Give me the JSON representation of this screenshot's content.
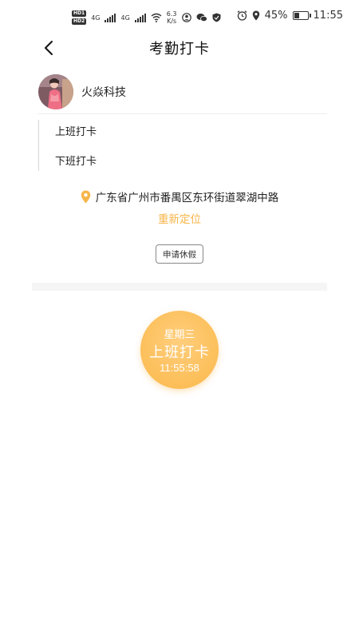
{
  "status_bar": {
    "hd1": "HD1",
    "hd2": "HD2",
    "net1": "4G",
    "net2": "4G",
    "speed_value": "6.3",
    "speed_unit": "K/s",
    "battery_text": "45%",
    "battery_level": 0.45,
    "time": "11:55"
  },
  "header": {
    "title": "考勤打卡",
    "back_icon": "chevron-left-icon"
  },
  "company": {
    "name": "火焱科技"
  },
  "records": [
    {
      "label": "上班打卡"
    },
    {
      "label": "下班打卡"
    }
  ],
  "location": {
    "icon": "location-pin-icon",
    "address": "广东省广州市番禺区东环街道翠湖中路",
    "relocate_label": "重新定位"
  },
  "leave_button": {
    "label": "申请休假"
  },
  "punch": {
    "weekday": "星期三",
    "label": "上班打卡",
    "time": "11:55:58"
  },
  "colors": {
    "accent": "#f7b54a",
    "punch_light": "#ffce7c",
    "divider": "#f5f5f5"
  }
}
